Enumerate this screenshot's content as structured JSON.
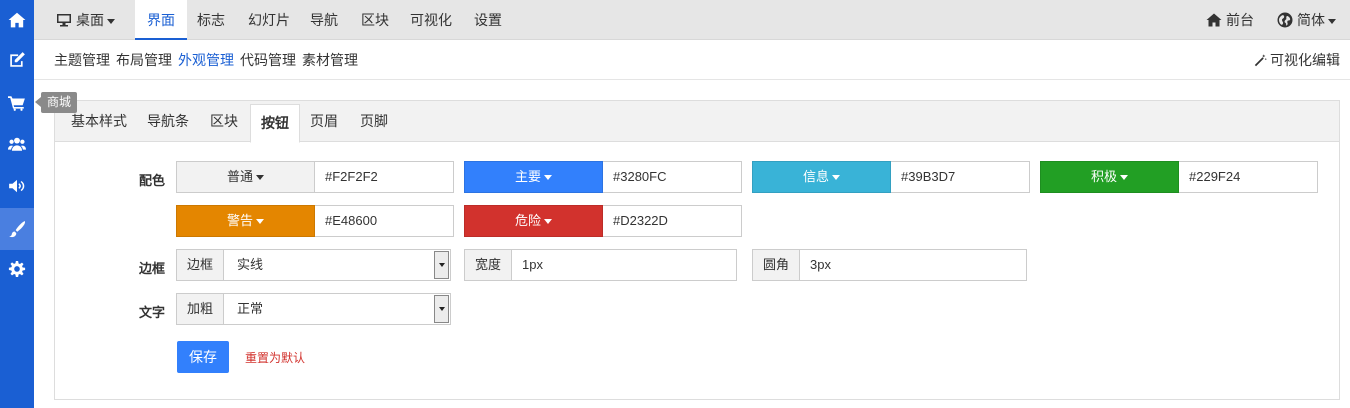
{
  "sidebar": {
    "items": [
      {
        "icon": "home-icon"
      },
      {
        "icon": "edit-icon"
      },
      {
        "icon": "cart-icon"
      },
      {
        "icon": "users-icon"
      },
      {
        "icon": "volume-icon"
      },
      {
        "icon": "brush-icon"
      },
      {
        "icon": "gear-icon"
      }
    ],
    "tooltip": "商城"
  },
  "topnav": {
    "desktop_label": "桌面",
    "items": [
      "界面",
      "标志",
      "幻灯片",
      "导航",
      "区块",
      "可视化",
      "设置"
    ],
    "frontend_label": "前台",
    "lang_label": "简体"
  },
  "subnav": {
    "items": [
      "主题管理",
      "布局管理",
      "外观管理",
      "代码管理",
      "素材管理"
    ],
    "visual_edit": "可视化编辑"
  },
  "tabs": [
    "基本样式",
    "导航条",
    "区块",
    "按钮",
    "页眉",
    "页脚"
  ],
  "form": {
    "color_label": "配色",
    "colors": [
      {
        "name": "普通",
        "value": "#F2F2F2",
        "bg": "#F2F2F2",
        "fg": "#333333"
      },
      {
        "name": "主要",
        "value": "#3280FC",
        "bg": "#3280FC",
        "fg": "#FFFFFF"
      },
      {
        "name": "信息",
        "value": "#39B3D7",
        "bg": "#39B3D7",
        "fg": "#FFFFFF"
      },
      {
        "name": "积极",
        "value": "#229F24",
        "bg": "#229F24",
        "fg": "#FFFFFF"
      },
      {
        "name": "警告",
        "value": "#E48600",
        "bg": "#E48600",
        "fg": "#FFFFFF"
      },
      {
        "name": "危险",
        "value": "#D2322D",
        "bg": "#D2322D",
        "fg": "#FFFFFF"
      }
    ],
    "border_label": "边框",
    "border_style_addon": "边框",
    "border_style_value": "实线",
    "width_addon": "宽度",
    "width_value": "1px",
    "radius_addon": "圆角",
    "radius_value": "3px",
    "text_label": "文字",
    "bold_addon": "加粗",
    "bold_value": "正常",
    "save_label": "保存",
    "reset_label": "重置为默认"
  }
}
